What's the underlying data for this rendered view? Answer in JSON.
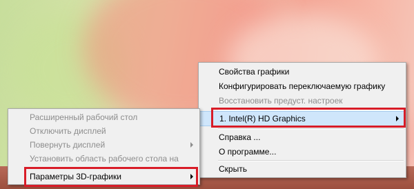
{
  "main_menu": {
    "items": [
      {
        "label": "Свойства графики",
        "enabled": true
      },
      {
        "label": "Конфигурировать переключаемую графику",
        "enabled": true
      },
      {
        "label": "Восстановить предуст. настроек",
        "enabled": false
      },
      {
        "label": "1. Intel(R) HD Graphics",
        "enabled": true,
        "submenu": true,
        "highlighted": true
      },
      {
        "label": "Справка ...",
        "enabled": true
      },
      {
        "label": "О программе...",
        "enabled": true
      },
      {
        "label": "Скрыть",
        "enabled": true
      }
    ]
  },
  "sub_menu": {
    "items": [
      {
        "label": "Расширенный рабочий стол",
        "enabled": false
      },
      {
        "label": "Отключить дисплей",
        "enabled": false
      },
      {
        "label": "Повернуть дисплей",
        "enabled": false,
        "submenu": true
      },
      {
        "label": "Установить область рабочего стола на",
        "enabled": false
      },
      {
        "label": "Параметры 3D-графики",
        "enabled": true,
        "submenu": true,
        "highlighted": true
      }
    ]
  },
  "colors": {
    "highlight_outline": "#d81c27",
    "hover_background": "#cfe6fb",
    "menu_background": "#f0f0f0",
    "disabled_text": "#8d8d8d"
  }
}
